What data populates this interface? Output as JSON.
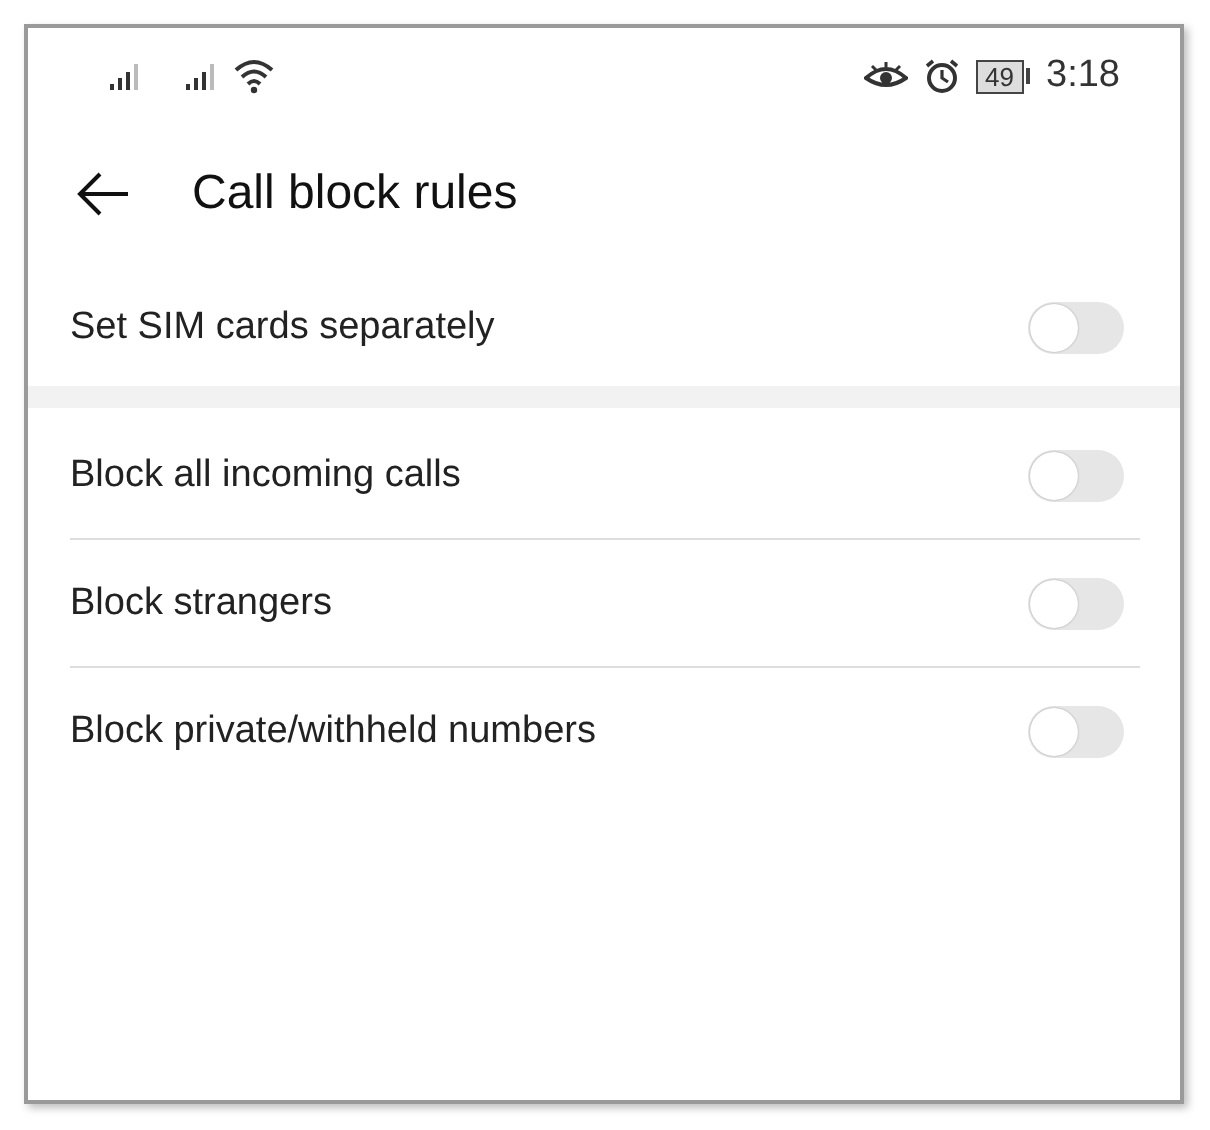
{
  "status_bar": {
    "battery": "49",
    "time": "3:18"
  },
  "header": {
    "title": "Call block rules"
  },
  "sections": [
    {
      "rows": [
        {
          "label": "Set SIM cards separately",
          "on": false
        }
      ]
    },
    {
      "rows": [
        {
          "label": "Block all incoming calls",
          "on": false
        },
        {
          "label": "Block strangers",
          "on": false
        },
        {
          "label": "Block private/withheld numbers",
          "on": false
        }
      ]
    }
  ]
}
